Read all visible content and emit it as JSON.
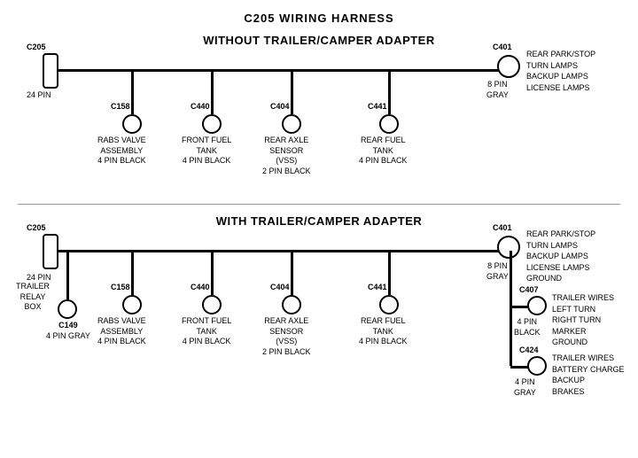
{
  "title": "C205 WIRING HARNESS",
  "section1": {
    "label": "WITHOUT TRAILER/CAMPER ADAPTER",
    "connectors": [
      {
        "id": "C205_top",
        "label": "C205",
        "sublabel": "24 PIN"
      },
      {
        "id": "C401_top",
        "label": "C401",
        "sublabel": "8 PIN\nGRAY"
      },
      {
        "id": "C158_top",
        "label": "C158",
        "sublabel": "RABS VALVE\nASSEMBLY\n4 PIN BLACK"
      },
      {
        "id": "C440_top",
        "label": "C440",
        "sublabel": "FRONT FUEL\nTANK\n4 PIN BLACK"
      },
      {
        "id": "C404_top",
        "label": "C404",
        "sublabel": "REAR AXLE\nSENSOR\n(VSS)\n2 PIN BLACK"
      },
      {
        "id": "C441_top",
        "label": "C441",
        "sublabel": "REAR FUEL\nTANK\n4 PIN BLACK"
      }
    ],
    "right_label": "REAR PARK/STOP\nTURN LAMPS\nBACKUP LAMPS\nLICENSE LAMPS"
  },
  "section2": {
    "label": "WITH TRAILER/CAMPER ADAPTER",
    "connectors": [
      {
        "id": "C205_bot",
        "label": "C205",
        "sublabel": "24 PIN"
      },
      {
        "id": "C401_bot",
        "label": "C401",
        "sublabel": "8 PIN\nGRAY"
      },
      {
        "id": "C158_bot",
        "label": "C158",
        "sublabel": "RABS VALVE\nASSEMBLY\n4 PIN BLACK"
      },
      {
        "id": "C440_bot",
        "label": "C440",
        "sublabel": "FRONT FUEL\nTANK\n4 PIN BLACK"
      },
      {
        "id": "C404_bot",
        "label": "C404",
        "sublabel": "REAR AXLE\nSENSOR\n(VSS)\n2 PIN BLACK"
      },
      {
        "id": "C441_bot",
        "label": "C441",
        "sublabel": "REAR FUEL\nTANK\n4 PIN BLACK"
      },
      {
        "id": "C149",
        "label": "C149",
        "sublabel": "4 PIN GRAY"
      },
      {
        "id": "C407",
        "label": "C407",
        "sublabel": "4 PIN\nBLACK"
      },
      {
        "id": "C424",
        "label": "C424",
        "sublabel": "4 PIN\nGRAY"
      }
    ],
    "right_labels": [
      "REAR PARK/STOP\nTURN LAMPS\nBACKUP LAMPS\nLICENSE LAMPS\nGROUND",
      "TRAILER WIRES\nLEFT TURN\nRIGHT TURN\nMARKER\nGROUND",
      "TRAILER WIRES\nBATTERY CHARGE\nBACKUP\nBRAKES"
    ],
    "trailer_relay": "TRAILER\nRELAY\nBOX"
  }
}
